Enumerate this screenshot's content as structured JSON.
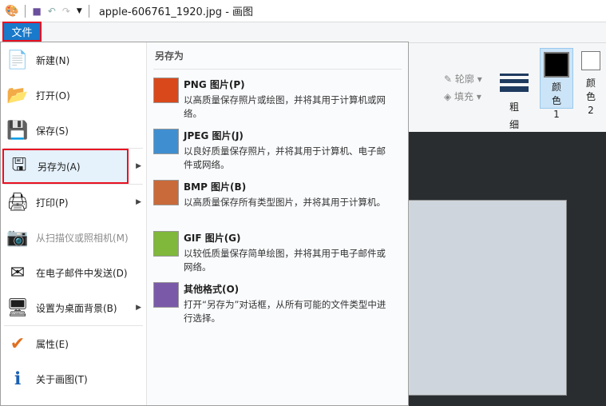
{
  "title": "apple-606761_1920.jpg - 画图",
  "file_tab": "文件",
  "left_items": [
    {
      "label": "新建(N)",
      "icon": "new-file-icon",
      "arrow": false
    },
    {
      "label": "打开(O)",
      "icon": "folder-open-icon",
      "arrow": false
    },
    {
      "label": "保存(S)",
      "icon": "floppy-save-icon",
      "arrow": false
    },
    {
      "label": "另存为(A)",
      "icon": "save-as-icon",
      "arrow": true
    },
    {
      "label": "打印(P)",
      "icon": "printer-icon",
      "arrow": true
    },
    {
      "label": "从扫描仪或照相机(M)",
      "icon": "scanner-icon",
      "arrow": false,
      "disabled": true
    },
    {
      "label": "在电子邮件中发送(D)",
      "icon": "email-icon",
      "arrow": false
    },
    {
      "label": "设置为桌面背景(B)",
      "icon": "desktop-background-icon",
      "arrow": true
    },
    {
      "label": "属性(E)",
      "icon": "checkmark-icon",
      "arrow": false
    },
    {
      "label": "关于画图(T)",
      "icon": "info-icon",
      "arrow": false
    }
  ],
  "submenu": {
    "header": "另存为",
    "items": [
      {
        "title": "PNG 图片(P)",
        "desc": "以高质量保存照片或绘图，并将其用于计算机或网络。",
        "color": "#d9481a"
      },
      {
        "title": "JPEG 图片(J)",
        "desc": "以良好质量保存照片，并将其用于计算机、电子邮件或网络。",
        "color": "#3f8fd0"
      },
      {
        "title": "BMP 图片(B)",
        "desc": "以高质量保存所有类型图片，并将其用于计算机。",
        "color": "#c96a3a"
      },
      {
        "title": "GIF 图片(G)",
        "desc": "以较低质量保存简单绘图，并将其用于电子邮件或网络。",
        "color": "#7fb83a"
      },
      {
        "title": "其他格式(O)",
        "desc": "打开“另存为”对话框，从所有可能的文件类型中进行选择。",
        "color": "#7a5aa8"
      }
    ]
  },
  "ribbon": {
    "outline": "轮廓",
    "fill": "填充",
    "size": "粗细",
    "color1": "颜色 1",
    "color2": "颜色 2"
  }
}
